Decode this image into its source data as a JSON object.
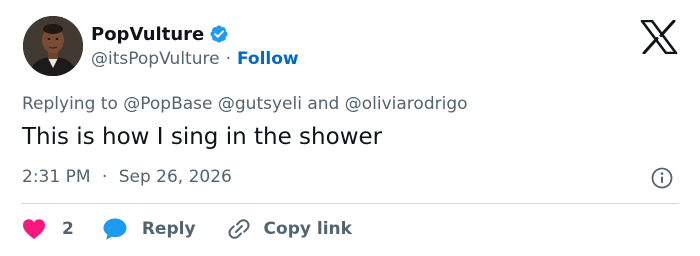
{
  "tweet": {
    "author": {
      "display_name": "PopVulture",
      "handle": "@itsPopVulture",
      "verified": true,
      "follow_label": "Follow",
      "separator": "·"
    },
    "replying_to": {
      "prefix": "Replying to",
      "mentions": [
        "@PopBase",
        "@gutsyeli"
      ],
      "conjunction": "and",
      "last_mention": "@oliviarodrigo"
    },
    "text": "This is how I sing in the shower",
    "time": "2:31 PM",
    "date_separator": "·",
    "date": "Sep 26, 2026"
  },
  "actions": {
    "like_count": "2",
    "reply_label": "Reply",
    "copy_label": "Copy link"
  },
  "icons": {
    "verified": "verified-badge-icon",
    "platform": "x-logo-icon",
    "info": "info-icon",
    "like": "heart-icon",
    "reply": "speech-bubble-icon",
    "copy": "link-icon"
  },
  "colors": {
    "link_blue": "#0069ca",
    "verified_blue": "#1d9bf0",
    "heart_pink": "#f91880",
    "muted_text": "#536471",
    "primary_text": "#0f1419"
  }
}
